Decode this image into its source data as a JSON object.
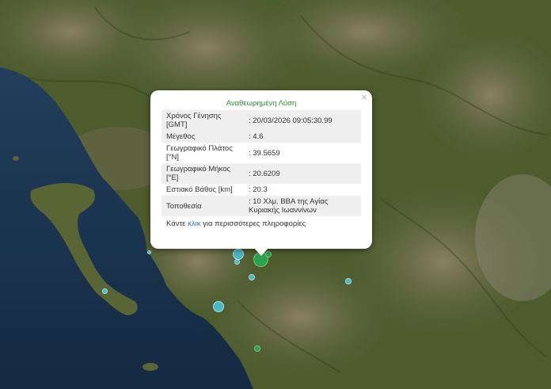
{
  "popup": {
    "title": "Αναθεωρημένη Λύση",
    "close_icon": "×",
    "rows": [
      {
        "label": "Χρόνος Γένησης [GMT]",
        "value": ": 20/03/2026 09:05:30.99"
      },
      {
        "label": "Μέγεθος",
        "value": ": 4.6"
      },
      {
        "label": "Γεωγραφικό Πλάτος [°N]",
        "value": ": 39.5659"
      },
      {
        "label": "Γεωγραφικό Μήκος [°E]",
        "value": ": 20.6209"
      },
      {
        "label": "Εστιακό Βάθος [km]",
        "value": ": 20.3"
      },
      {
        "label": "Τοποθεσία",
        "value": ": 10 Χλμ. ΒΒΑ της Αγίας Κυριακής Ιωαννίνων"
      }
    ],
    "more_prefix": "Κάντε",
    "more_link": "κλικ",
    "more_suffix": "για περισσότερες πληροφορίες"
  },
  "colors": {
    "sea": "#1f3a55",
    "land": "#4a5a2c",
    "link": "#2a6ad0",
    "title_green": "#2e8a2e",
    "marker_blue": "#46c8e1",
    "marker_green": "#28aa50"
  },
  "icons": {
    "close": "close-icon",
    "marker": "earthquake-marker-icon"
  }
}
